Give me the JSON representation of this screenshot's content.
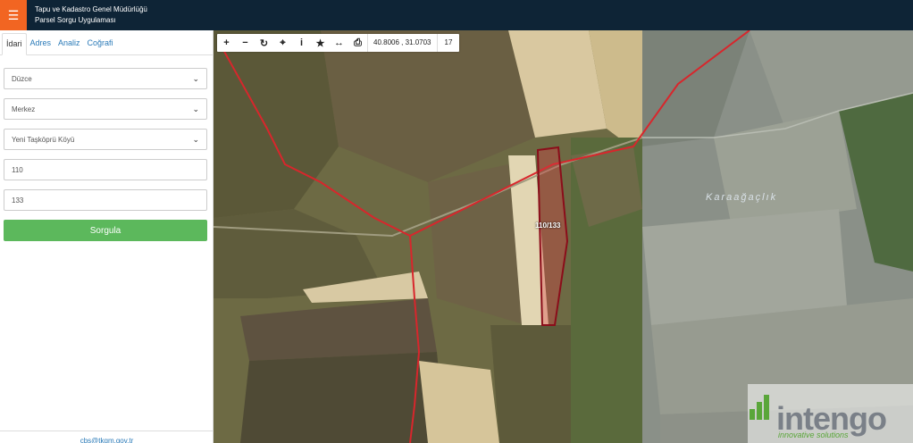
{
  "header": {
    "menu_icon": "hamburger-icon",
    "title_line1": "Tapu ve Kadastro Genel Müdürlüğü",
    "title_line2": "Parsel Sorgu Uygulaması",
    "accent_color": "#f26522",
    "bar_color": "#0e2436"
  },
  "sidebar": {
    "tabs": [
      {
        "label": "İdari",
        "active": true
      },
      {
        "label": "Adres",
        "active": false
      },
      {
        "label": "Analiz",
        "active": false
      },
      {
        "label": "Coğrafi",
        "active": false
      }
    ],
    "province": "Düzce",
    "district": "Merkez",
    "neighborhood": "Yeni Taşköprü Köyü",
    "block_no": "110",
    "parcel_no": "133",
    "query_button": "Sorgula",
    "query_button_color": "#5cb85c",
    "footer_email": "cbs@tkgm.gov.tr"
  },
  "map": {
    "toolbar": {
      "tools": [
        "zoom-in-icon",
        "zoom-out-icon",
        "refresh-icon",
        "locate-icon",
        "info-icon",
        "bookmark-star-icon",
        "measure-icon",
        "print-icon"
      ],
      "coordinates": "40.8006 , 31.0703",
      "zoom_level": "17"
    },
    "parcel_label": "110/133",
    "place_label": "Karaağaçlık",
    "logo_text": "intengo",
    "logo_tagline": "innovative solutions"
  }
}
